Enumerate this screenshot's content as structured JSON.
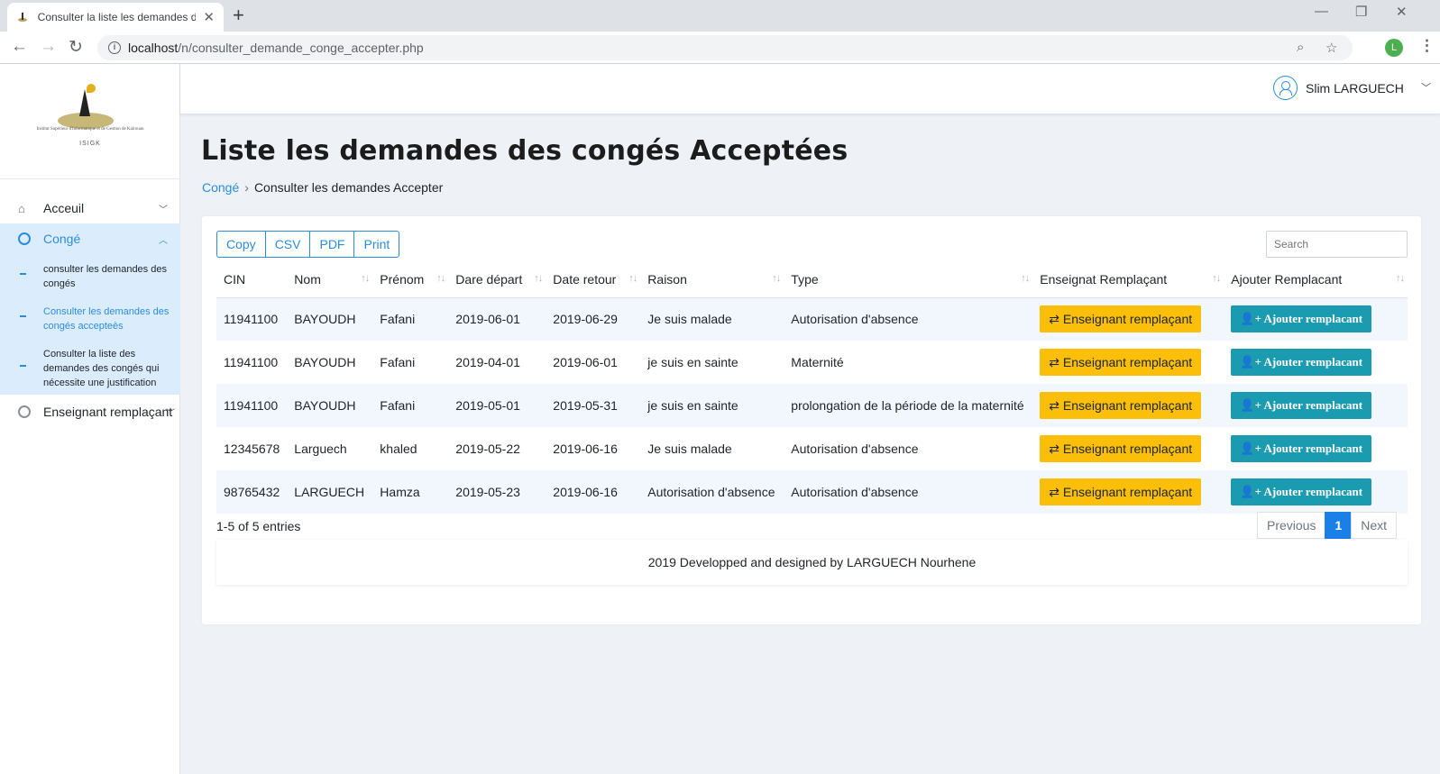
{
  "browser": {
    "tab_title": "Consulter la liste les demandes d",
    "url_host": "localhost",
    "url_path": "/n/consulter_demande_conge_accepter.php",
    "profile_initial": "L"
  },
  "sidebar": {
    "logo_text": "Institut Supérieur d'Informatique et de Gestion de Kairouan",
    "logo_acronym": "ISIGK",
    "items": [
      {
        "label": "Acceuil",
        "icon": "home-icon"
      },
      {
        "label": "Congé",
        "icon": "user-circle-icon"
      },
      {
        "label": "Enseignant remplaçant",
        "icon": "user-icon"
      }
    ],
    "sub_items": [
      {
        "label": "consulter les demandes des congés"
      },
      {
        "label": "Consulter les demandes des congés accepteès"
      },
      {
        "label": "Consulter la liste des demandes des congés qui nécessite une justification"
      }
    ]
  },
  "header": {
    "user_name": "Slim LARGUECH"
  },
  "page": {
    "title": "Liste les demandes des congés Acceptées",
    "breadcrumb": {
      "link": "Congé",
      "current": "Consulter les demandes Accepter"
    }
  },
  "toolbar": {
    "buttons": [
      "Copy",
      "CSV",
      "PDF",
      "Print"
    ],
    "search_placeholder": "Search"
  },
  "table": {
    "columns": [
      "CIN",
      "Nom",
      "Prénom",
      "Dare départ",
      "Date retour",
      "Raison",
      "Type",
      "Enseignat Remplaçant",
      "Ajouter Remplacant"
    ],
    "rows": [
      {
        "cin": "11941100",
        "nom": "BAYOUDH",
        "prenom": "Fafani",
        "depart": "2019-06-01",
        "retour": "2019-06-29",
        "raison": "Je suis malade",
        "type": "Autorisation d'absence"
      },
      {
        "cin": "11941100",
        "nom": "BAYOUDH",
        "prenom": "Fafani",
        "depart": "2019-04-01",
        "retour": "2019-06-01",
        "raison": "je suis en sainte",
        "type": "Maternité"
      },
      {
        "cin": "11941100",
        "nom": "BAYOUDH",
        "prenom": "Fafani",
        "depart": "2019-05-01",
        "retour": "2019-05-31",
        "raison": "je suis en sainte",
        "type": "prolongation de la période de la maternité"
      },
      {
        "cin": "12345678",
        "nom": "Larguech",
        "prenom": "khaled",
        "depart": "2019-05-22",
        "retour": "2019-06-16",
        "raison": "Je suis malade",
        "type": "Autorisation d'absence"
      },
      {
        "cin": "98765432",
        "nom": "LARGUECH",
        "prenom": "Hamza",
        "depart": "2019-05-23",
        "retour": "2019-06-16",
        "raison": "Autorisation d'absence",
        "type": "Autorisation d'absence"
      }
    ],
    "btn_remplacant": "Enseignant remplaçant",
    "btn_ajouter": "Ajouter remplacant"
  },
  "pagination": {
    "info": "1-5 of 5 entries",
    "previous": "Previous",
    "current": "1",
    "next": "Next"
  },
  "footer": {
    "text": "2019 Developped and designed by LARGUECH Nourhene"
  },
  "colors": {
    "primary": "#2b8cde",
    "warning": "#fbbf0a",
    "info": "#1a9bb0"
  }
}
